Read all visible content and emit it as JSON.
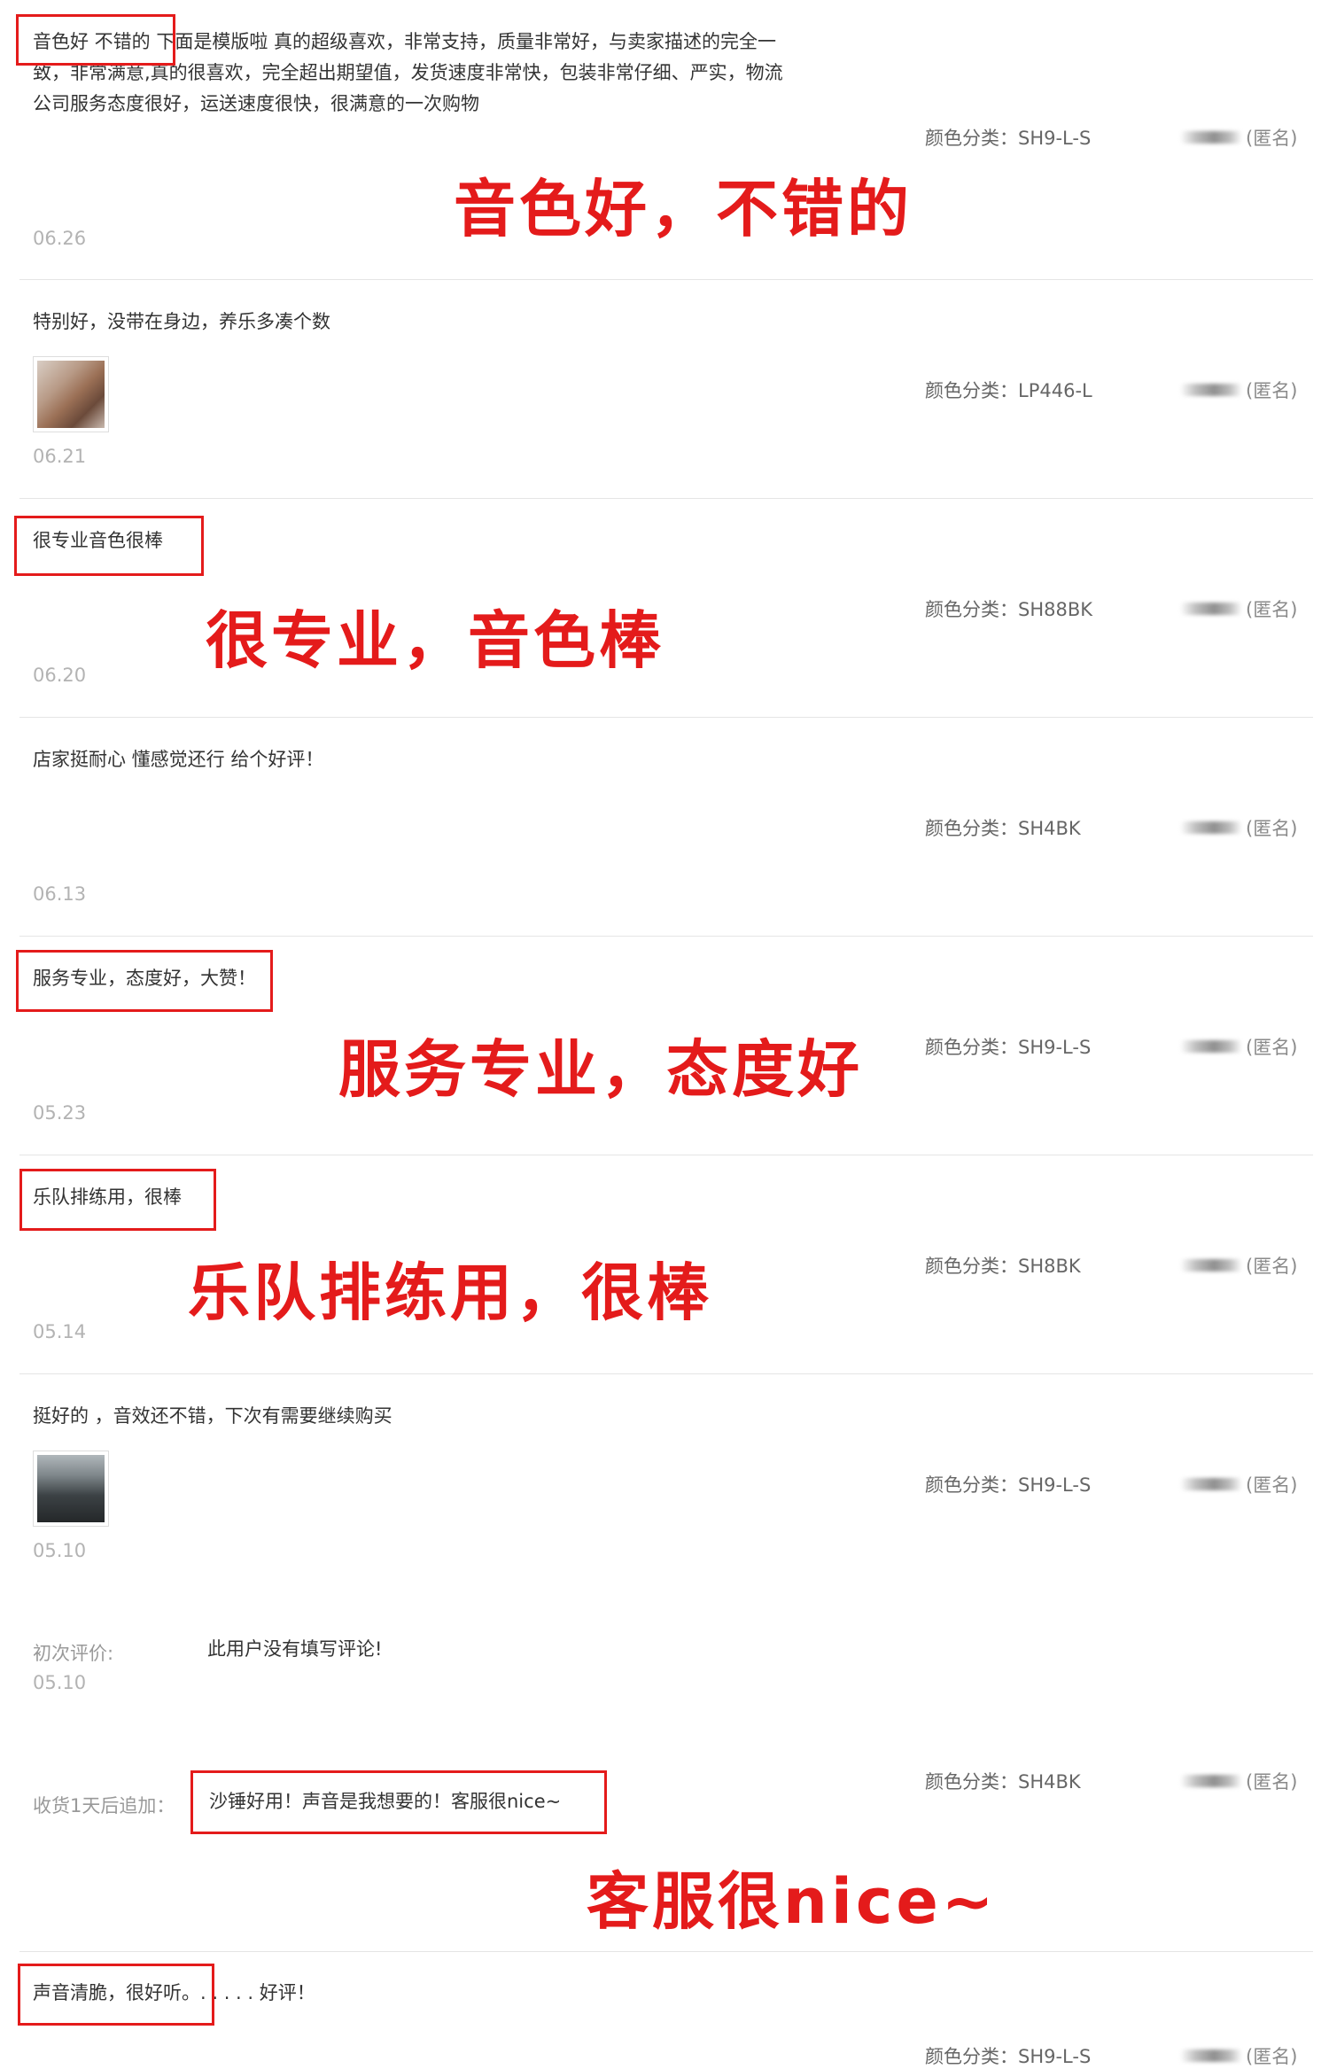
{
  "reviews": [
    {
      "text_line1": "音色好 不错的 下面是模版啦 真的超级喜欢，非常支持，质量非常好，与卖家描述的完全一",
      "text_line2": "致，非常满意,真的很喜欢，完全超出期望值，发货速度非常快，包装非常仔细、严实，物流",
      "text_line3": "公司服务态度很好，运送速度很快，很满意的一次购物",
      "sku": "颜色分类：SH9-L-S",
      "user": "(匿名)",
      "date": "06.26",
      "callout": "音色好，不错的"
    },
    {
      "text": "特别好，没带在身边，养乐多凑个数",
      "sku": "颜色分类：LP446-L",
      "user": "(匿名)",
      "date": "06.21"
    },
    {
      "text": "很专业音色很棒",
      "sku": "颜色分类：SH88BK",
      "user": "(匿名)",
      "date": "06.20",
      "callout": "很专业，音色棒"
    },
    {
      "text": "店家挺耐心 懂感觉还行 给个好评！",
      "sku": "颜色分类：SH4BK",
      "user": "(匿名)",
      "date": "06.13"
    },
    {
      "text": "服务专业，态度好，大赞！",
      "sku": "颜色分类：SH9-L-S",
      "user": "(匿名)",
      "date": "05.23",
      "callout": "服务专业，态度好"
    },
    {
      "text": "乐队排练用，很棒",
      "sku": "颜色分类：SH8BK",
      "user": "(匿名)",
      "date": "05.14",
      "callout": "乐队排练用，很棒"
    },
    {
      "text": "挺好的 ，音效还不错，下次有需要继续购买",
      "sku": "颜色分类：SH9-L-S",
      "user": "(匿名)",
      "date": "05.10",
      "initial_label": "初次评价:",
      "initial_text": "此用户没有填写评论!",
      "initial_date": "05.10",
      "followup_label": "收货1天后追加：",
      "followup_text": "沙锤好用！声音是我想要的！客服很nice~",
      "followup_sku": "颜色分类：SH4BK",
      "followup_user": "(匿名)",
      "callout": "客服很nice~"
    },
    {
      "text": "声音清脆，很好听。. . . . . 好评！",
      "sku": "颜色分类：SH9-L-S",
      "user": "(匿名)"
    }
  ]
}
